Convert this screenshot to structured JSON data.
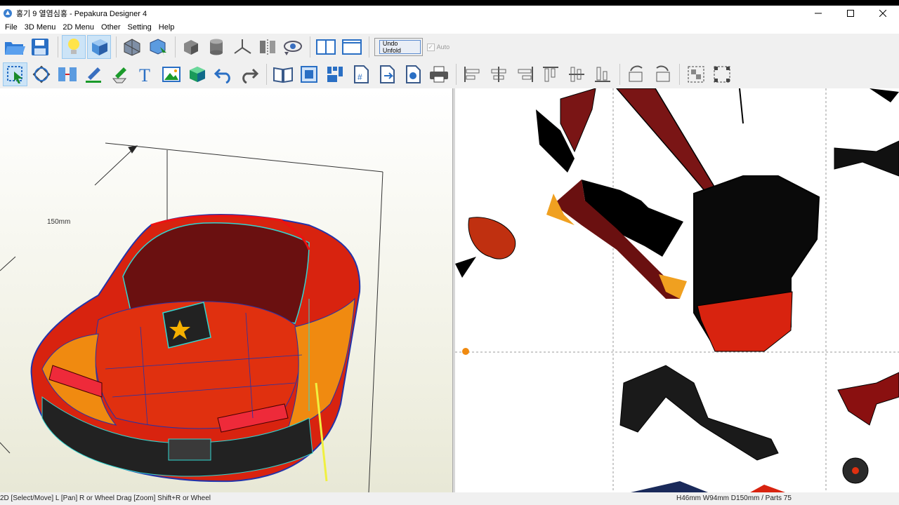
{
  "window": {
    "title": "홍기 9 열염심홍 - Pepakura Designer 4",
    "controls": [
      "minimize",
      "maximize",
      "close"
    ]
  },
  "menu": [
    "File",
    "3D Menu",
    "2D Menu",
    "Other",
    "Setting",
    "Help"
  ],
  "toolbar_top": {
    "undo_unfold_label": "Undo Unfold",
    "auto_label": "Auto",
    "auto_checked": true
  },
  "view3d": {
    "dimension_label": "150mm"
  },
  "status": {
    "left": "2D [Select/Move] L [Pan] R or Wheel Drag [Zoom] Shift+R or Wheel",
    "right": "H46mm W94mm D150mm / Parts 75"
  },
  "colors": {
    "selected_tool_bg": "#cce4f7",
    "model_red": "#d8230f",
    "model_orange": "#f08a10",
    "wire_blue": "#2233aa",
    "wire_cyan": "#33d5d0"
  }
}
